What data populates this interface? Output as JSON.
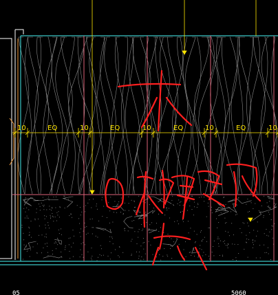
{
  "colors": {
    "background": "#000000",
    "cyan_border": "#39c6c6",
    "panel_line": "#e0637a",
    "wood_grain": "#8a8a8a",
    "dimension": "#ffe600",
    "markup": "#ff1f1f",
    "left_edge": "#f29a3a"
  },
  "dimensions": {
    "labels": [
      {
        "gap": "10",
        "eq": "EQ"
      },
      {
        "gap": "10",
        "eq": "EQ"
      },
      {
        "gap": "10",
        "eq": "EQ"
      },
      {
        "gap": "10",
        "eq": "EQ"
      },
      {
        "gap": "10",
        "eq": ""
      }
    ]
  },
  "bottom": {
    "left_fragment": "05",
    "right_fragment": "5060"
  },
  "markup": {
    "description_icons": [
      "handwritten-wood-character-icon",
      "handwritten-stone-characters-icon"
    ]
  }
}
